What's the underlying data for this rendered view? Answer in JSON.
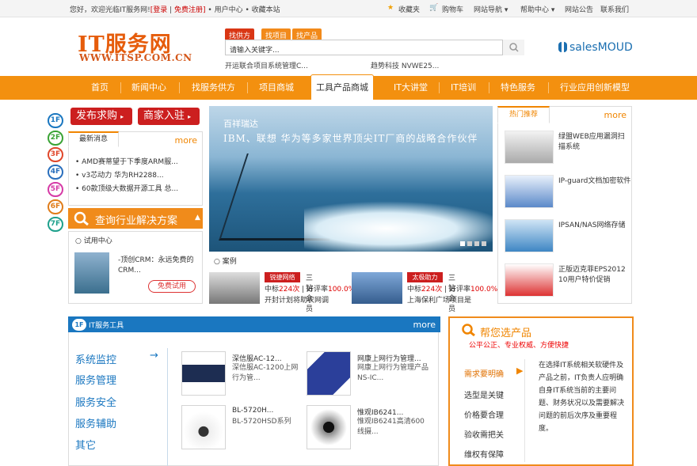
{
  "topbar": {
    "greeting": "您好，欢迎光临IT服务网!",
    "login": "[登录",
    "register": "免费注册]",
    "user_center": "用户中心",
    "bookmark": "收藏本站",
    "favorites": "收藏夹",
    "cart": "购物车",
    "site_nav": "网站导航",
    "help": "帮助中心",
    "notice": "网站公告",
    "contact": "联系我们"
  },
  "header": {
    "logo_main": "IT服务网",
    "logo_sub": "WWW.ITSP.COM.CN",
    "search_tabs": [
      "找供方",
      "找项目",
      "找产品"
    ],
    "search_placeholder": "请输入关键字...",
    "hot1": "开运联合项目系统管理C...",
    "hot2": "趋势科技 NVWE25...",
    "partner": "salesMOUD"
  },
  "nav": [
    "首页",
    "新闻中心",
    "找服务供方",
    "项目商城",
    "工具产品商城",
    "IT大讲堂",
    "IT培训",
    "特色服务",
    "行业应用创新模型"
  ],
  "floors": [
    "1F",
    "2F",
    "3F",
    "4F",
    "5F",
    "6F",
    "7F"
  ],
  "left": {
    "post_btn": "发布求购",
    "join_btn": "商家入驻",
    "news_tab": "最新消息",
    "more": "more",
    "news": [
      "AMD赛蒂望于下季度ARM服...",
      "v3芯动力 华为RH2288...",
      "60款顶级大数据开源工具 总..."
    ],
    "query": "查询行业解决方案",
    "trial_hd": "试用中心",
    "trial_text": "-顶创CRM：永远免费的CRM...",
    "trial_btn": "免费试用"
  },
  "banner": {
    "t1": "百祥瑞达",
    "t2": "IBM、联想  华为等多家世界顶尖IT厂商的战略合作伙伴"
  },
  "cases": {
    "hd": "案例",
    "items": [
      {
        "tag": "锐捷网络",
        "level": "三钻会员",
        "bid": "中标",
        "bid_n": "224次",
        "rate": "好评率",
        "rate_n": "100.0%",
        "desc": "开封计划将助农网调"
      },
      {
        "tag": "太极助力",
        "level": "三钻会员",
        "bid": "中标",
        "bid_n": "224次",
        "rate": "好评率",
        "rate_n": "100.0%",
        "desc": "上海保利广场项目是"
      }
    ]
  },
  "hot": {
    "tab": "热门推荐",
    "more": "more",
    "items": [
      "绿盟WEB应用漏洞扫描系统",
      "IP-guard文档加密软件",
      "IPSAN/NAS网络存储",
      "正版迈克菲EPS2012 10用户特价促销"
    ]
  },
  "tools": {
    "floor": "1F",
    "title": "IT服务工具",
    "more": "more",
    "cats": [
      "系统监控",
      "服务管理",
      "服务安全",
      "服务辅助",
      "其它"
    ],
    "products": [
      {
        "t1": "深信服AC-12...",
        "t2": "深信服AC-1200上网行为管..."
      },
      {
        "t1": "网康上网行为管理...",
        "t2": "网康上网行为管理产品NS-IC..."
      },
      {
        "t1": "BL-5720H...",
        "t2": "BL-5720HSD系列"
      },
      {
        "t1": "惟观IB6241...",
        "t2": "惟观IB6241高清600线摄..."
      }
    ]
  },
  "help": {
    "title": "帮您选产品",
    "sub": "公平公正、专业权威、方便快捷",
    "menu": [
      "需求要明确",
      "选型是关键",
      "价格要合理",
      "验收需把关",
      "维权有保障"
    ],
    "desc": "在选择IT系统相关软硬件及产品之前，IT负责人应明确自身IT系统当前的主要问题、财务状况以及需要解决问题的前后次序及重要程度。"
  },
  "colors": {
    "orange": "#f3900f",
    "red": "#cc1f1f",
    "blue": "#1a77c0"
  }
}
